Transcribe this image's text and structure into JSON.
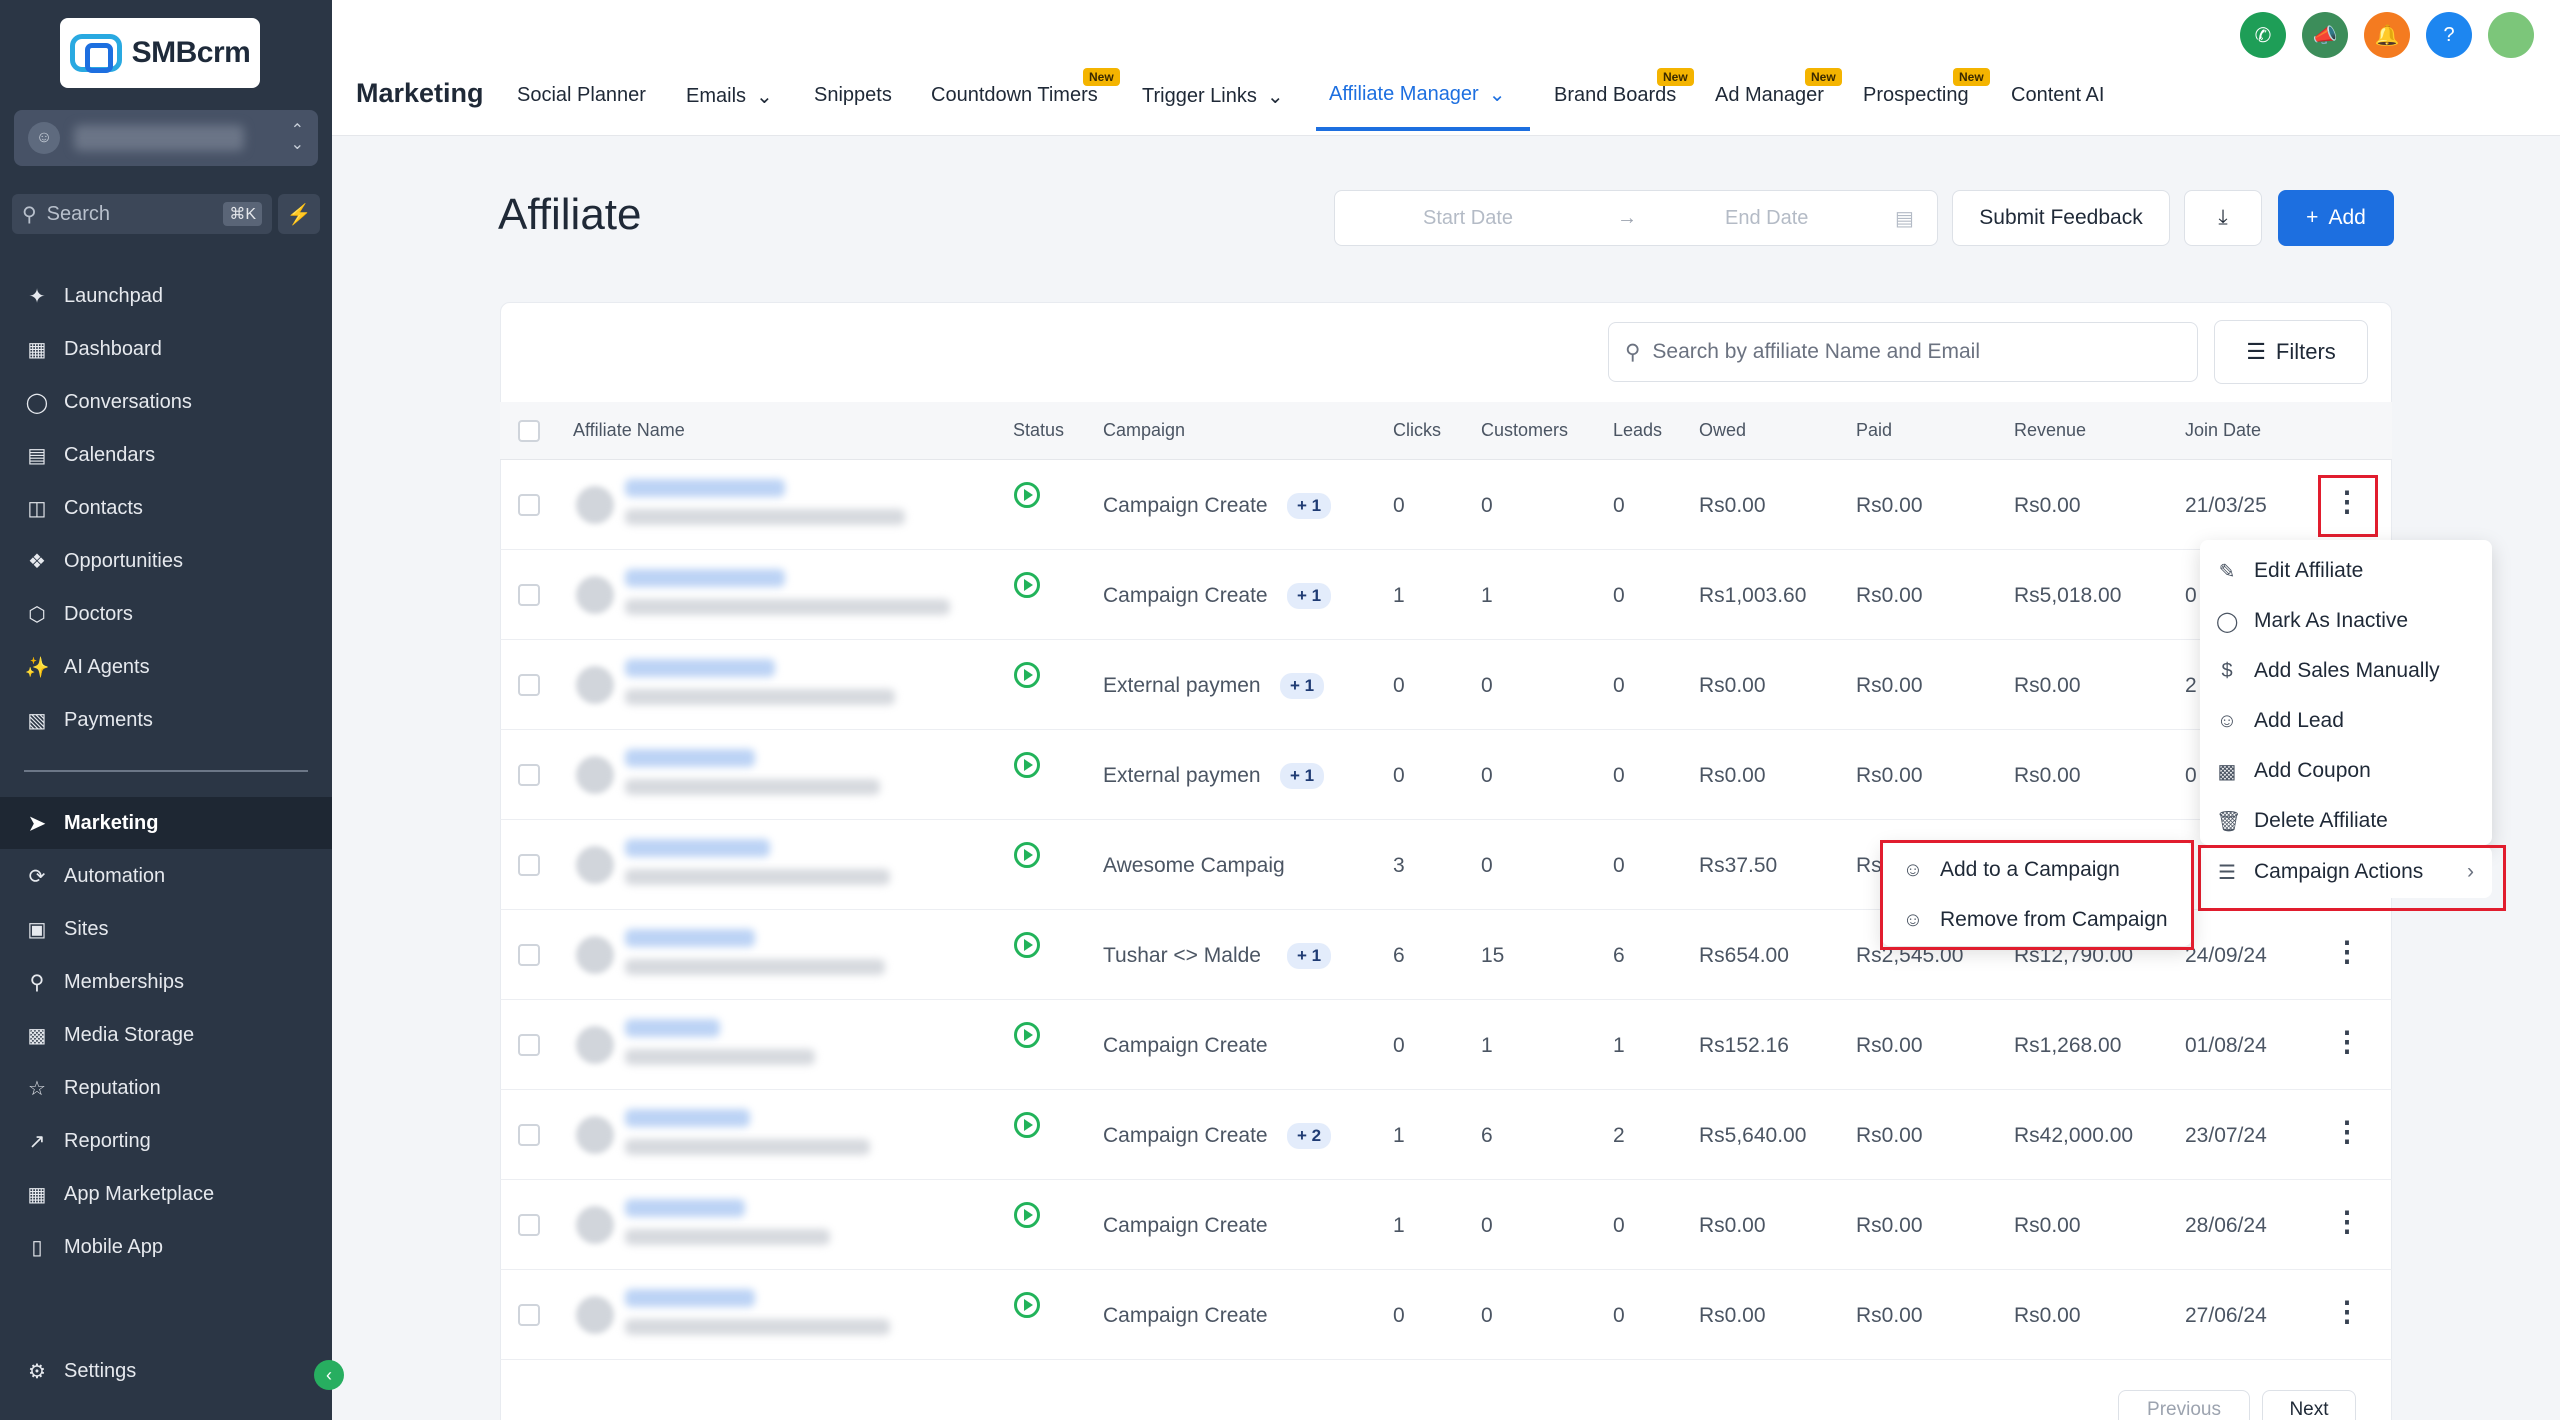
{
  "brand": {
    "name": "SMBcrm"
  },
  "sidebar": {
    "search_placeholder": "Search",
    "search_shortcut": "⌘K",
    "items": [
      {
        "label": "Launchpad",
        "icon": "rocket-icon"
      },
      {
        "label": "Dashboard",
        "icon": "grid-icon"
      },
      {
        "label": "Conversations",
        "icon": "chat-icon"
      },
      {
        "label": "Calendars",
        "icon": "calendar-icon"
      },
      {
        "label": "Contacts",
        "icon": "contacts-icon"
      },
      {
        "label": "Opportunities",
        "icon": "funnel-icon"
      },
      {
        "label": "Doctors",
        "icon": "box-icon"
      },
      {
        "label": "AI Agents",
        "icon": "sparkle-icon"
      },
      {
        "label": "Payments",
        "icon": "receipt-icon"
      },
      {
        "label": "Marketing",
        "icon": "send-icon"
      },
      {
        "label": "Automation",
        "icon": "automation-icon"
      },
      {
        "label": "Sites",
        "icon": "sites-icon"
      },
      {
        "label": "Memberships",
        "icon": "badge-icon"
      },
      {
        "label": "Media Storage",
        "icon": "image-icon"
      },
      {
        "label": "Reputation",
        "icon": "star-icon"
      },
      {
        "label": "Reporting",
        "icon": "trend-icon"
      },
      {
        "label": "App Marketplace",
        "icon": "apps-icon"
      },
      {
        "label": "Mobile App",
        "icon": "phone-icon"
      }
    ],
    "settings_label": "Settings"
  },
  "topbar": {
    "title": "Marketing",
    "tabs": [
      {
        "label": "Social Planner"
      },
      {
        "label": "Emails"
      },
      {
        "label": "Snippets"
      },
      {
        "label": "Countdown Timers",
        "badge": "New"
      },
      {
        "label": "Trigger Links"
      },
      {
        "label": "Affiliate Manager"
      },
      {
        "label": "Brand Boards",
        "badge": "New"
      },
      {
        "label": "Ad Manager",
        "badge": "New"
      },
      {
        "label": "Prospecting",
        "badge": "New"
      },
      {
        "label": "Content AI"
      }
    ],
    "colors": {
      "phone": "#1e9e57",
      "megaphone": "#3c8d5a",
      "bell": "#f47b20",
      "help": "#1d86f0",
      "avatar": "#7cc67a"
    }
  },
  "page": {
    "title": "Affiliate",
    "start_date_placeholder": "Start Date",
    "end_date_placeholder": "End Date",
    "submit_feedback": "Submit Feedback",
    "add_label": "Add",
    "search_placeholder": "Search by affiliate Name and Email",
    "filters_label": "Filters"
  },
  "table": {
    "headers": [
      "Affiliate Name",
      "Status",
      "Campaign",
      "Clicks",
      "Customers",
      "Leads",
      "Owed",
      "Paid",
      "Revenue",
      "Join Date"
    ],
    "rows": [
      {
        "campaign": "Campaign Create",
        "extra": "+ 1",
        "clicks": "0",
        "customers": "0",
        "leads": "0",
        "owed": "Rs0.00",
        "paid": "Rs0.00",
        "revenue": "Rs0.00",
        "join": "21/03/25"
      },
      {
        "campaign": "Campaign Create",
        "extra": "+ 1",
        "clicks": "1",
        "customers": "1",
        "leads": "0",
        "owed": "Rs1,003.60",
        "paid": "Rs0.00",
        "revenue": "Rs5,018.00",
        "join": "0"
      },
      {
        "campaign": "External paymen",
        "extra": "+ 1",
        "clicks": "0",
        "customers": "0",
        "leads": "0",
        "owed": "Rs0.00",
        "paid": "Rs0.00",
        "revenue": "Rs0.00",
        "join": "2"
      },
      {
        "campaign": "External paymen",
        "extra": "+ 1",
        "clicks": "0",
        "customers": "0",
        "leads": "0",
        "owed": "Rs0.00",
        "paid": "Rs0.00",
        "revenue": "Rs0.00",
        "join": "0"
      },
      {
        "campaign": "Awesome Campaig",
        "extra": "",
        "clicks": "3",
        "customers": "0",
        "leads": "0",
        "owed": "Rs37.50",
        "paid": "Rs",
        "revenue": "",
        "join": ""
      },
      {
        "campaign": "Tushar <> Malde",
        "extra": "+ 1",
        "clicks": "6",
        "customers": "15",
        "leads": "6",
        "owed": "Rs654.00",
        "paid": "Rs2,545.00",
        "revenue": "Rs12,790.00",
        "join": "24/09/24"
      },
      {
        "campaign": "Campaign Create",
        "extra": "",
        "clicks": "0",
        "customers": "1",
        "leads": "1",
        "owed": "Rs152.16",
        "paid": "Rs0.00",
        "revenue": "Rs1,268.00",
        "join": "01/08/24"
      },
      {
        "campaign": "Campaign Create",
        "extra": "+ 2",
        "clicks": "1",
        "customers": "6",
        "leads": "2",
        "owed": "Rs5,640.00",
        "paid": "Rs0.00",
        "revenue": "Rs42,000.00",
        "join": "23/07/24"
      },
      {
        "campaign": "Campaign Create",
        "extra": "",
        "clicks": "1",
        "customers": "0",
        "leads": "0",
        "owed": "Rs0.00",
        "paid": "Rs0.00",
        "revenue": "Rs0.00",
        "join": "28/06/24"
      },
      {
        "campaign": "Campaign Create",
        "extra": "",
        "clicks": "0",
        "customers": "0",
        "leads": "0",
        "owed": "Rs0.00",
        "paid": "Rs0.00",
        "revenue": "Rs0.00",
        "join": "27/06/24"
      }
    ]
  },
  "action_menu": {
    "items": [
      "Edit Affiliate",
      "Mark As Inactive",
      "Add Sales Manually",
      "Add Lead",
      "Add Coupon",
      "Delete Affiliate",
      "Campaign Actions"
    ]
  },
  "campaign_submenu": {
    "items": [
      "Add to a Campaign",
      "Remove from Campaign"
    ]
  },
  "pagination": {
    "previous": "Previous",
    "next": "Next"
  }
}
